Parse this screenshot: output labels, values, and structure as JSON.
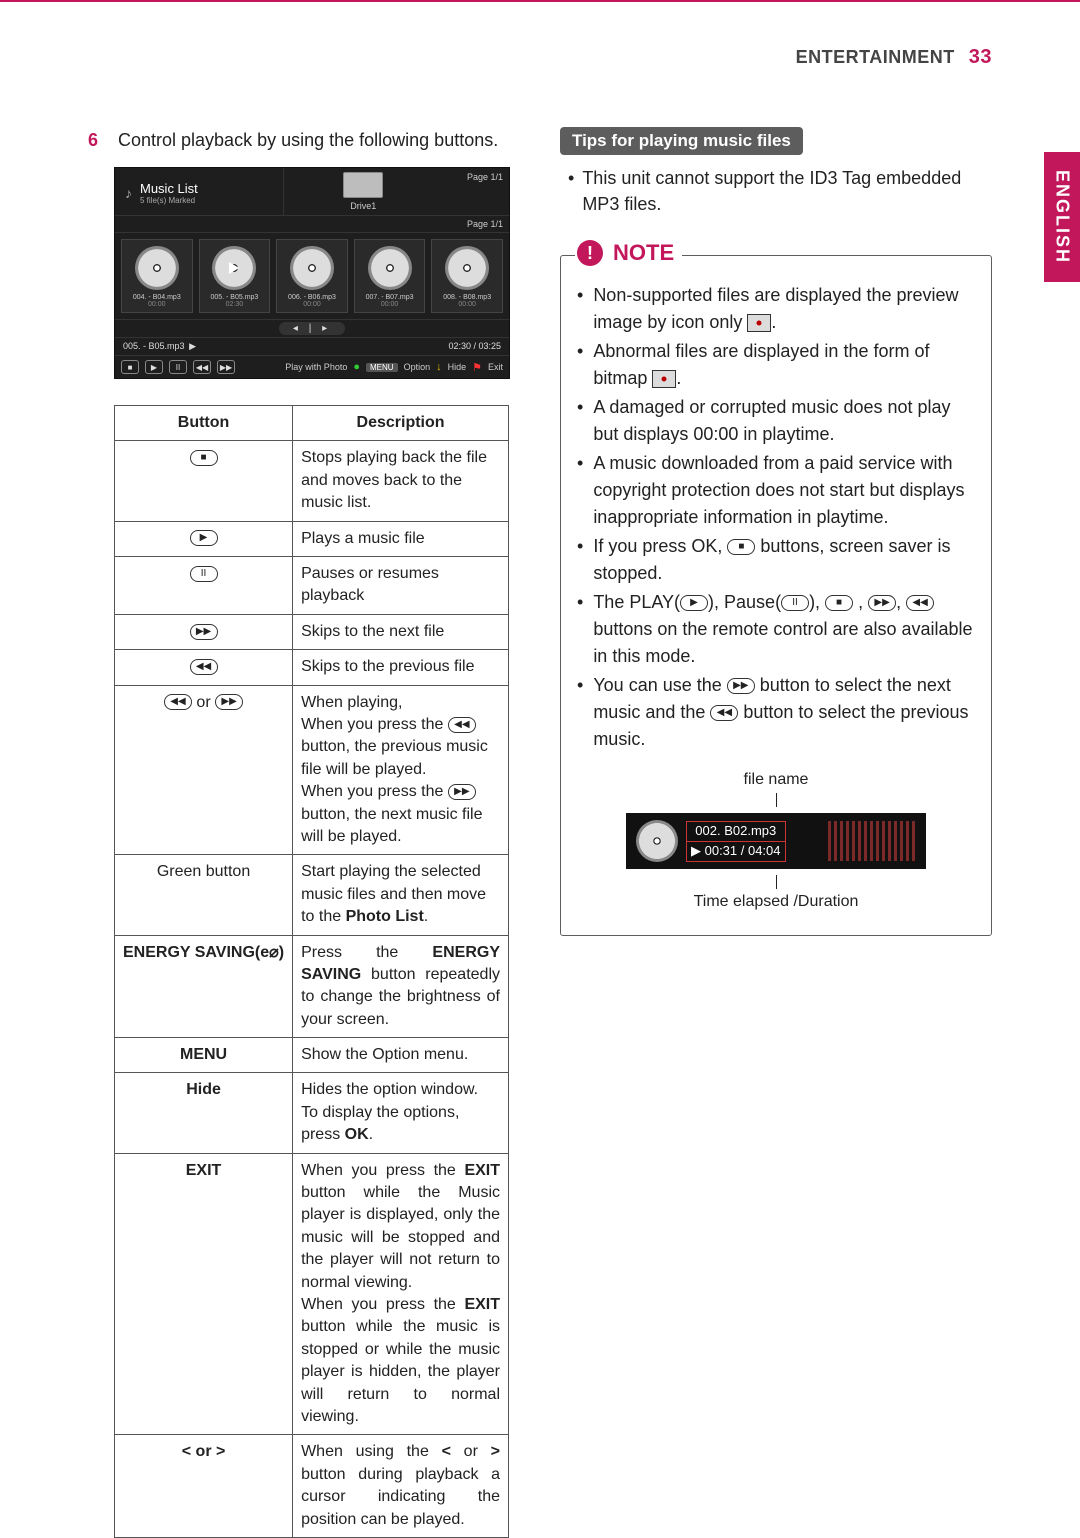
{
  "header": {
    "section": "ENTERTAINMENT",
    "page": "33",
    "sidetab": "ENGLISH"
  },
  "step": {
    "num": "6",
    "text": "Control playback by using the following buttons."
  },
  "music_shot": {
    "title": "Music List",
    "subtitle": "5 file(s) Marked",
    "drive_label": "Drive1",
    "page_top": "Page 1/1",
    "page_row": "Page 1/1",
    "thumbs": [
      {
        "name": "004. - B04.mp3",
        "time": "00:00"
      },
      {
        "name": "005. - B05.mp3",
        "time": "02:30"
      },
      {
        "name": "006. - B06.mp3",
        "time": "00:00"
      },
      {
        "name": "007. - B07.mp3",
        "time": "00:00"
      },
      {
        "name": "008. - B08.mp3",
        "time": "00:00"
      }
    ],
    "pager": "◂ | ▸",
    "now_playing": "005. - B05.mp3",
    "elapsed": "02:30 / 03:25",
    "bottom": {
      "play_with_photo": "Play with Photo",
      "menu": "MENU",
      "option": "Option",
      "hide": "Hide",
      "exit": "Exit"
    }
  },
  "table": {
    "head": {
      "button": "Button",
      "desc": "Description"
    },
    "rows": [
      {
        "b_icon": "■",
        "d": "Stops playing back the file and moves back to the music list."
      },
      {
        "b_icon": "▶",
        "d": "Plays a music file"
      },
      {
        "b_icon": "II",
        "d": "Pauses or resumes playback"
      },
      {
        "b_icon": "▶▶",
        "d": "Skips to the next file"
      },
      {
        "b_icon": "◀◀",
        "d": "Skips to the previous file"
      },
      {
        "b_html": "◀◀_or_▶▶",
        "d_html": "When playing,<br>When you press the <span class='ibtn'>◀◀</span> button, the previous music file will be played.<br>When you press the <span class='ibtn'>▶▶</span> button, the next music file will be played."
      },
      {
        "b_text": "Green button",
        "d_html": "Start playing the selected music files and then move to the <b>Photo List</b>."
      },
      {
        "b_html_bold": "ENERGY SAVING(e⌀)",
        "d_html": "Press the <b>ENERGY SAVING</b> button repeatedly to change the brightness of your screen."
      },
      {
        "b_bold": "MENU",
        "d": "Show the Option menu."
      },
      {
        "b_bold": "Hide",
        "d_html": "Hides the option window.<br>To display the options, press <b>OK</b>."
      },
      {
        "b_bold": "EXIT",
        "d_html": "When you press the <b>EXIT</b> button while the Music player is displayed, only the music will be stopped and the player will not return to normal viewing.<br>When you press the <b>EXIT</b> button while the music is stopped or while the music player is hidden, the player will return to normal  viewing."
      },
      {
        "b_bold": "< or >",
        "d_html": "When using the <b>&lt;</b> or <b>&gt;</b> button during playback a cursor indicating the position can be played."
      }
    ]
  },
  "tips": {
    "title": "Tips for playing music files",
    "item": "This unit cannot support the ID3 Tag embedded MP3 files."
  },
  "note": {
    "title": "NOTE",
    "items": [
      "Non-supported files are displayed the preview image by icon only __BMP__.",
      "Abnormal files are displayed in the form of bitmap __BMP__.",
      "A damaged or corrupted music does not play but displays 00:00 in playtime.",
      "A music downloaded from a paid service with copyright protection does not start but displays inappropriate information in playtime.",
      "If you press OK, __BTN_STOP__ buttons, screen saver is stopped.",
      "The PLAY(__BTN_PLAY__), Pause(__BTN_PAUSE__), __BTN_STOP__ , __BTN_FF__, __BTN_RW__ buttons on the remote control are also available in this mode.",
      "You can use the __BTN_FF__ button to select the next music and the __BTN_RW__ button to select the previous music."
    ]
  },
  "diagram": {
    "file_label": "file name",
    "track": "002. B02.mp3",
    "time": "▶ 00:31 / 04:04",
    "caption": "Time elapsed /Duration"
  }
}
